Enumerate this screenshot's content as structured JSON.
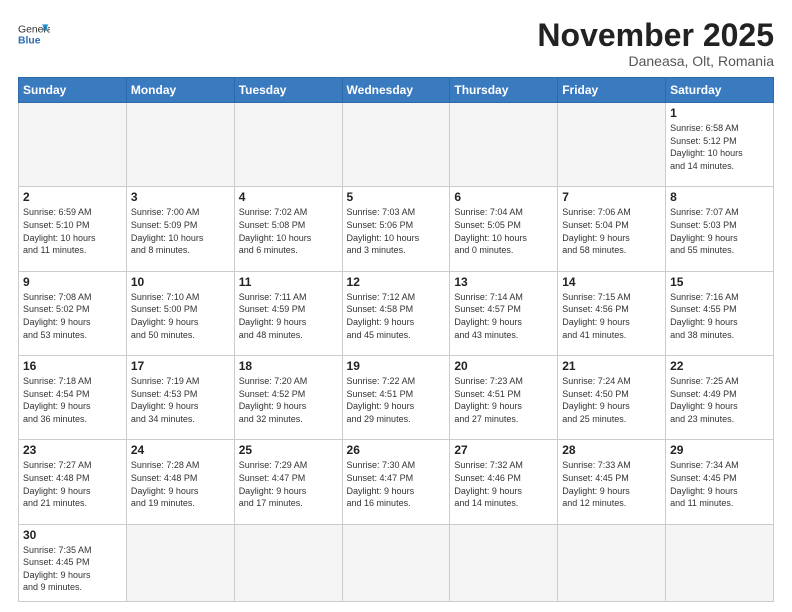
{
  "header": {
    "logo_general": "General",
    "logo_blue": "Blue",
    "month_title": "November 2025",
    "location": "Daneasa, Olt, Romania"
  },
  "weekdays": [
    "Sunday",
    "Monday",
    "Tuesday",
    "Wednesday",
    "Thursday",
    "Friday",
    "Saturday"
  ],
  "weeks": [
    [
      {
        "day": "",
        "info": ""
      },
      {
        "day": "",
        "info": ""
      },
      {
        "day": "",
        "info": ""
      },
      {
        "day": "",
        "info": ""
      },
      {
        "day": "",
        "info": ""
      },
      {
        "day": "",
        "info": ""
      },
      {
        "day": "1",
        "info": "Sunrise: 6:58 AM\nSunset: 5:12 PM\nDaylight: 10 hours\nand 14 minutes."
      }
    ],
    [
      {
        "day": "2",
        "info": "Sunrise: 6:59 AM\nSunset: 5:10 PM\nDaylight: 10 hours\nand 11 minutes."
      },
      {
        "day": "3",
        "info": "Sunrise: 7:00 AM\nSunset: 5:09 PM\nDaylight: 10 hours\nand 8 minutes."
      },
      {
        "day": "4",
        "info": "Sunrise: 7:02 AM\nSunset: 5:08 PM\nDaylight: 10 hours\nand 6 minutes."
      },
      {
        "day": "5",
        "info": "Sunrise: 7:03 AM\nSunset: 5:06 PM\nDaylight: 10 hours\nand 3 minutes."
      },
      {
        "day": "6",
        "info": "Sunrise: 7:04 AM\nSunset: 5:05 PM\nDaylight: 10 hours\nand 0 minutes."
      },
      {
        "day": "7",
        "info": "Sunrise: 7:06 AM\nSunset: 5:04 PM\nDaylight: 9 hours\nand 58 minutes."
      },
      {
        "day": "8",
        "info": "Sunrise: 7:07 AM\nSunset: 5:03 PM\nDaylight: 9 hours\nand 55 minutes."
      }
    ],
    [
      {
        "day": "9",
        "info": "Sunrise: 7:08 AM\nSunset: 5:02 PM\nDaylight: 9 hours\nand 53 minutes."
      },
      {
        "day": "10",
        "info": "Sunrise: 7:10 AM\nSunset: 5:00 PM\nDaylight: 9 hours\nand 50 minutes."
      },
      {
        "day": "11",
        "info": "Sunrise: 7:11 AM\nSunset: 4:59 PM\nDaylight: 9 hours\nand 48 minutes."
      },
      {
        "day": "12",
        "info": "Sunrise: 7:12 AM\nSunset: 4:58 PM\nDaylight: 9 hours\nand 45 minutes."
      },
      {
        "day": "13",
        "info": "Sunrise: 7:14 AM\nSunset: 4:57 PM\nDaylight: 9 hours\nand 43 minutes."
      },
      {
        "day": "14",
        "info": "Sunrise: 7:15 AM\nSunset: 4:56 PM\nDaylight: 9 hours\nand 41 minutes."
      },
      {
        "day": "15",
        "info": "Sunrise: 7:16 AM\nSunset: 4:55 PM\nDaylight: 9 hours\nand 38 minutes."
      }
    ],
    [
      {
        "day": "16",
        "info": "Sunrise: 7:18 AM\nSunset: 4:54 PM\nDaylight: 9 hours\nand 36 minutes."
      },
      {
        "day": "17",
        "info": "Sunrise: 7:19 AM\nSunset: 4:53 PM\nDaylight: 9 hours\nand 34 minutes."
      },
      {
        "day": "18",
        "info": "Sunrise: 7:20 AM\nSunset: 4:52 PM\nDaylight: 9 hours\nand 32 minutes."
      },
      {
        "day": "19",
        "info": "Sunrise: 7:22 AM\nSunset: 4:51 PM\nDaylight: 9 hours\nand 29 minutes."
      },
      {
        "day": "20",
        "info": "Sunrise: 7:23 AM\nSunset: 4:51 PM\nDaylight: 9 hours\nand 27 minutes."
      },
      {
        "day": "21",
        "info": "Sunrise: 7:24 AM\nSunset: 4:50 PM\nDaylight: 9 hours\nand 25 minutes."
      },
      {
        "day": "22",
        "info": "Sunrise: 7:25 AM\nSunset: 4:49 PM\nDaylight: 9 hours\nand 23 minutes."
      }
    ],
    [
      {
        "day": "23",
        "info": "Sunrise: 7:27 AM\nSunset: 4:48 PM\nDaylight: 9 hours\nand 21 minutes."
      },
      {
        "day": "24",
        "info": "Sunrise: 7:28 AM\nSunset: 4:48 PM\nDaylight: 9 hours\nand 19 minutes."
      },
      {
        "day": "25",
        "info": "Sunrise: 7:29 AM\nSunset: 4:47 PM\nDaylight: 9 hours\nand 17 minutes."
      },
      {
        "day": "26",
        "info": "Sunrise: 7:30 AM\nSunset: 4:47 PM\nDaylight: 9 hours\nand 16 minutes."
      },
      {
        "day": "27",
        "info": "Sunrise: 7:32 AM\nSunset: 4:46 PM\nDaylight: 9 hours\nand 14 minutes."
      },
      {
        "day": "28",
        "info": "Sunrise: 7:33 AM\nSunset: 4:45 PM\nDaylight: 9 hours\nand 12 minutes."
      },
      {
        "day": "29",
        "info": "Sunrise: 7:34 AM\nSunset: 4:45 PM\nDaylight: 9 hours\nand 11 minutes."
      }
    ],
    [
      {
        "day": "30",
        "info": "Sunrise: 7:35 AM\nSunset: 4:45 PM\nDaylight: 9 hours\nand 9 minutes."
      },
      {
        "day": "",
        "info": ""
      },
      {
        "day": "",
        "info": ""
      },
      {
        "day": "",
        "info": ""
      },
      {
        "day": "",
        "info": ""
      },
      {
        "day": "",
        "info": ""
      },
      {
        "day": "",
        "info": ""
      }
    ]
  ]
}
